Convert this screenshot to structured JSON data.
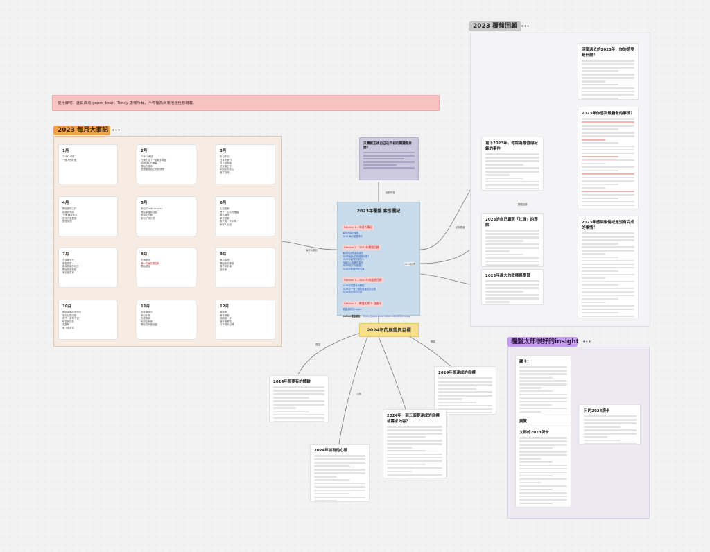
{
  "notice": "使用聲明：此頁面為 gopro_bear、Teddy 版權所有，不得複為商業用途任意轉載。",
  "sections": {
    "monthly": {
      "label": "2023 每月大事記",
      "more": "•••"
    },
    "review": {
      "label": "2023 覆盤回顧",
      "more": "•••"
    },
    "insight": {
      "label": "覆盤太郎很好的insight",
      "more": "•••"
    }
  },
  "months": [
    {
      "name": "1月",
      "lines": [
        "TOEFL考試",
        "一個人的年假"
      ]
    },
    {
      "name": "2月",
      "lines": [
        "TOEFL考試",
        "在線上買了一台新手電腦",
        "Vuellaa 的開幕",
        "開始去游泳",
        "想想要換個工作的環境"
      ]
    },
    {
      "name": "3月",
      "lines": [
        "去日本玩",
        "日本大阪行",
        "買了新電腦",
        "決定換工作",
        "和朋友去爬山",
        "做了投資"
      ]
    },
    {
      "name": "4月",
      "lines": [
        "開始新的工作",
        "認識新同事",
        "上課 練習英文",
        "週末去看展覽",
        "整理房間"
      ]
    },
    {
      "name": "5月",
      "lines": [
        "參加了 side project",
        "開始學習新技能",
        "和朋友吃飯",
        "參加了研討會"
      ]
    },
    {
      "name": "6月",
      "lines": [
        "生日快樂",
        "買了一台新的電腦",
        "報名課程",
        "學會做菜",
        "跑了第一次半馬",
        "和家人出遊"
      ]
    },
    {
      "name": "7月",
      "lines": [
        "去京都旅行",
        "學習攝影",
        "搬家到新的地方",
        "開始寫部落格",
        "參加讀書會"
      ]
    },
    {
      "name": "8月",
      "lines": [
        "去海邊玩",
        "第一次報名馬拉松",
        "開始健身"
      ]
    },
    {
      "name": "9月",
      "lines": [
        "參加婚禮",
        "開始新的專案",
        "換了新手機",
        "回老家"
      ]
    },
    {
      "name": "10月",
      "lines": [
        "開始準備年底旅行",
        "參加社群活動",
        "寫了一本電子書",
        "學習新技能",
        "去露營",
        "看了很多書"
      ]
    },
    {
      "name": "11月",
      "lines": [
        "去韓國旅行",
        "參加年會",
        "完成專案",
        "和朋友聚會",
        "開始寫年度回顧"
      ]
    },
    {
      "name": "12月",
      "lines": [
        "聖誕節",
        "跨年倒數",
        "回顧這一年",
        "做年度覆盤",
        "訂下明年目標"
      ]
    }
  ],
  "center": {
    "title": "2023年覆盤 索引圖記",
    "sections": [
      {
        "label": "Section 1 – 每月大事記",
        "links": [
          "每月大事記總覽",
          "2023 每月重要事件"
        ]
      },
      {
        "label": "Section 2 – 2023年覆盤回顧",
        "links": [
          "每月的目標達成狀況",
          "你今年最大的收穫是什麼？",
          "2023年最想感謝的人",
          "你最引以為傲的事情",
          "你今年犯了什麼錯？",
          "2023年覆盤問題清單"
        ]
      },
      {
        "label": "Section 3 – 2024年的展望目標",
        "links": [
          "2024年想要有的體驗",
          "2024年一到三個想要達成的目標",
          "2024年該有的心態"
        ]
      },
      {
        "label": "Section 4 – 覆盤太郎 & 插畫卡",
        "links": [
          "覆盤太郎的insight"
        ]
      }
    ],
    "footer_label": "Notion覆盤模板：",
    "footer_link": "https://gopro-bear.notion.site/2023review"
  },
  "purple_note": {
    "title": "只需要正視自己在年初的關鍵是什麼？"
  },
  "goals_title": "2024年的展望與目標",
  "review_cards": [
    {
      "title": "回望過去的2023年，你的感受是什麼？"
    },
    {
      "title": "2023年你感到最驕傲的事情？"
    },
    {
      "title": "2023年感到後悔或是沒有完成的事情？"
    },
    {
      "title": "寫下2023年，你認為最值得紀錄的事件"
    },
    {
      "title": "2023的自己顯現「忙碌」的理解"
    },
    {
      "title": "2023年最大的收穫與學習"
    }
  ],
  "goal_cards": [
    {
      "title": "2024年想要有的體驗"
    },
    {
      "title": "2024年想達成的目標"
    },
    {
      "title": "2024年一到三個要達成的目標或需求內容？"
    },
    {
      "title": "2024年該有的心態"
    }
  ],
  "insight_cards": [
    {
      "title": "藏卡："
    },
    {
      "title": "展覽："
    },
    {
      "title": "太郎的2023牌卡"
    },
    {
      "title": "🃏的2024牌卡"
    }
  ],
  "edge_labels": [
    "每月大事記",
    "回顧年度",
    "延伸覆盤",
    "整體回顧",
    "2024目標",
    "展望",
    "體驗",
    "心態"
  ]
}
